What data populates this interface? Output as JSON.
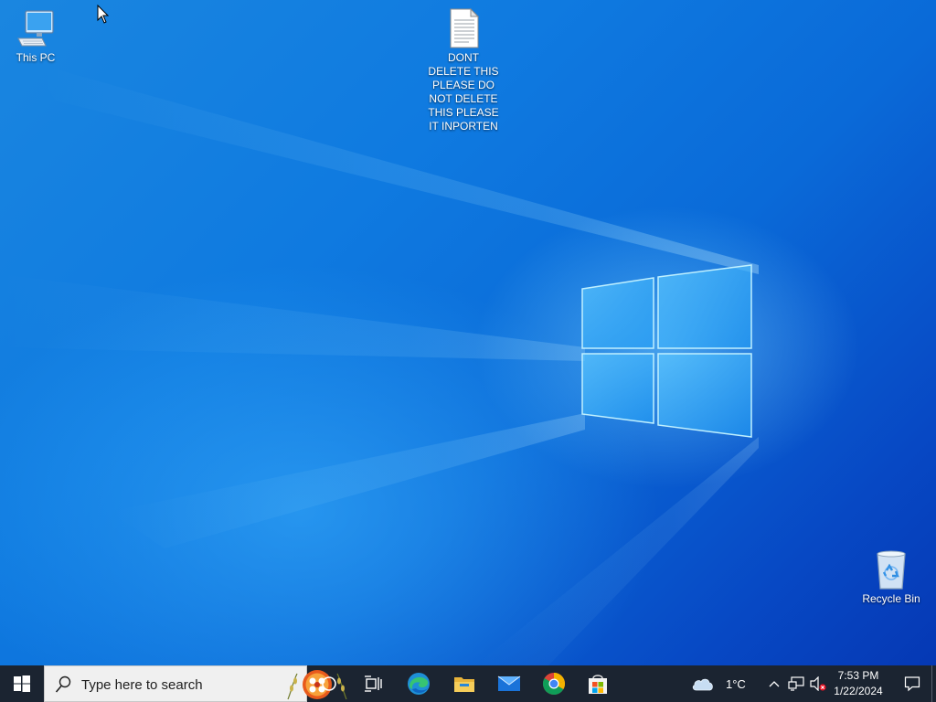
{
  "desktop": {
    "icons": [
      {
        "name": "this-pc",
        "label": "This PC"
      },
      {
        "name": "text-document",
        "label": "DONT DELETE THIS PLEASE DO NOT DELETE THIS PLEASE IT INPORTEN"
      },
      {
        "name": "recycle-bin",
        "label": "Recycle Bin"
      }
    ],
    "colors": {
      "wallpaper_top": "#1a86e0",
      "wallpaper_bottom": "#0538b4",
      "logo_glow": "#8fd8ff"
    }
  },
  "taskbar": {
    "search": {
      "placeholder": "Type here to search"
    },
    "pinned": [
      "start-icon",
      "cortana-icon",
      "task-view-icon",
      "edge-icon",
      "file-explorer-icon",
      "mail-icon",
      "chrome-icon",
      "store-icon"
    ],
    "weather": {
      "temp": "1°C",
      "icon": "cloud-icon"
    },
    "tray": {
      "icons": [
        "chevron-up-icon",
        "network-icon",
        "volume-muted-icon"
      ]
    },
    "clock": {
      "time": "7:53 PM",
      "date": "1/22/2024"
    },
    "notification_icon": "action-center-icon",
    "colors": {
      "background": "#1b2431",
      "search_bg": "#f0f0f0"
    }
  }
}
